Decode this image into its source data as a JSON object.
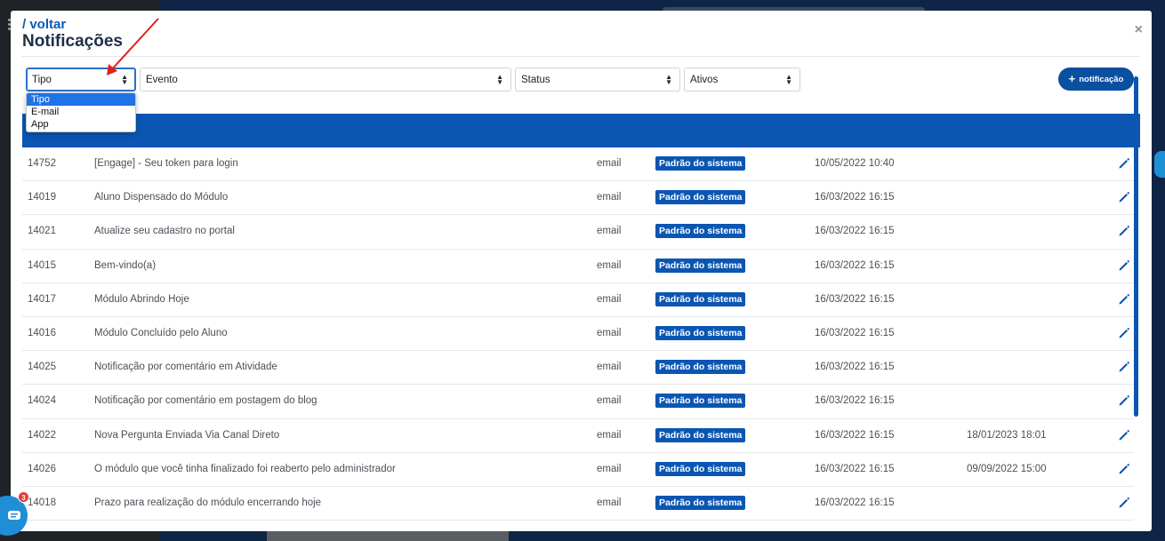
{
  "header": {
    "back_label": "/ voltar",
    "title": "Notificações",
    "close_symbol": "×"
  },
  "filters": {
    "tipo": {
      "value": "Tipo",
      "options": [
        "Tipo",
        "E-mail",
        "App"
      ]
    },
    "evento": {
      "value": "Evento"
    },
    "status": {
      "value": "Status"
    },
    "ativos": {
      "value": "Ativos"
    }
  },
  "add_button": {
    "label": "notificação"
  },
  "rows": [
    {
      "id": "14752",
      "name": "[Engage] - Seu token para login",
      "type": "email",
      "badge": "Padrão do sistema",
      "date": "10/05/2022 10:40",
      "date2": ""
    },
    {
      "id": "14019",
      "name": "Aluno Dispensado do Módulo",
      "type": "email",
      "badge": "Padrão do sistema",
      "date": "16/03/2022 16:15",
      "date2": ""
    },
    {
      "id": "14021",
      "name": "Atualize seu cadastro no portal",
      "type": "email",
      "badge": "Padrão do sistema",
      "date": "16/03/2022 16:15",
      "date2": ""
    },
    {
      "id": "14015",
      "name": "Bem-vindo(a)",
      "type": "email",
      "badge": "Padrão do sistema",
      "date": "16/03/2022 16:15",
      "date2": ""
    },
    {
      "id": "14017",
      "name": "Módulo Abrindo Hoje",
      "type": "email",
      "badge": "Padrão do sistema",
      "date": "16/03/2022 16:15",
      "date2": ""
    },
    {
      "id": "14016",
      "name": "Módulo Concluído pelo Aluno",
      "type": "email",
      "badge": "Padrão do sistema",
      "date": "16/03/2022 16:15",
      "date2": ""
    },
    {
      "id": "14025",
      "name": "Notificação por comentário em Atividade",
      "type": "email",
      "badge": "Padrão do sistema",
      "date": "16/03/2022 16:15",
      "date2": ""
    },
    {
      "id": "14024",
      "name": "Notificação por comentário em postagem do blog",
      "type": "email",
      "badge": "Padrão do sistema",
      "date": "16/03/2022 16:15",
      "date2": ""
    },
    {
      "id": "14022",
      "name": "Nova Pergunta Enviada Via Canal Direto",
      "type": "email",
      "badge": "Padrão do sistema",
      "date": "16/03/2022 16:15",
      "date2": "18/01/2023 18:01"
    },
    {
      "id": "14026",
      "name": "O módulo que você tinha finalizado foi reaberto pelo administrador",
      "type": "email",
      "badge": "Padrão do sistema",
      "date": "16/03/2022 16:15",
      "date2": "09/09/2022 15:00"
    },
    {
      "id": "14018",
      "name": "Prazo para realização do módulo encerrando hoje",
      "type": "email",
      "badge": "Padrão do sistema",
      "date": "16/03/2022 16:15",
      "date2": ""
    }
  ],
  "chat": {
    "badge_count": "3"
  },
  "colors": {
    "primary": "#0a56b2",
    "link": "#0a5bb5",
    "accent": "#1e8fd6",
    "badge_red": "#e53935"
  }
}
